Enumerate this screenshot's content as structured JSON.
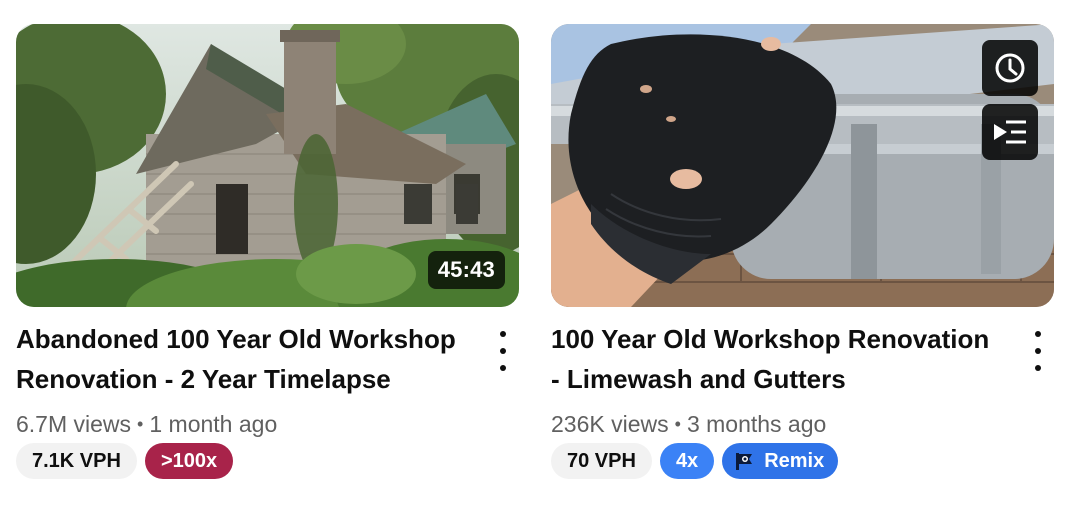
{
  "colors": {
    "ratio_red": "#a8234a",
    "ratio_blue": "#3b82f6",
    "remix_blue": "#2f73e8",
    "vph_bg": "#f2f2f2",
    "meta_text": "#606060"
  },
  "videos": [
    {
      "title_line1": "Abandoned 100 Year Old Workshop",
      "title_line2": "Renovation - 2 Year Timelapse",
      "duration": "45:43",
      "views": "6.7M views",
      "separator": "•",
      "age": "1 month ago",
      "vph": "7.1K VPH",
      "ratio": ">100x",
      "thumbnail_icon": "abandoned-brick-cottage-image",
      "menu_icon": "more-vertical-icon"
    },
    {
      "title_line1": "100 Year Old Workshop Renovation",
      "title_line2": "- Limewash and Gutters",
      "views": "236K views",
      "separator": "•",
      "age": "3 months ago",
      "vph": "70 VPH",
      "ratio": "4x",
      "remix": "Remix",
      "remix_icon": "remix-icon",
      "thumbnail_icon": "gloved-hand-gutter-image",
      "hover_buttons": [
        "watch-later-icon",
        "add-to-queue-icon"
      ],
      "menu_icon": "more-vertical-icon"
    }
  ]
}
